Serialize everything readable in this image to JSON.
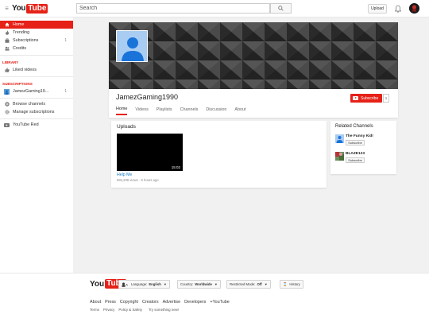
{
  "masthead": {
    "logo_you": "You",
    "logo_tube": "Tube",
    "search_placeholder": "Search",
    "upload_label": "Upload"
  },
  "sidebar": {
    "items": [
      {
        "label": "Home",
        "icon": "home-icon"
      },
      {
        "label": "Trending",
        "icon": "flame-icon"
      },
      {
        "label": "Subscriptions",
        "icon": "subscriptions-icon",
        "count": "1"
      },
      {
        "label": "Credits",
        "icon": "credits-icon"
      }
    ],
    "library_heading": "LIBRARY",
    "library_items": [
      {
        "label": "Liked videos",
        "icon": "thumbs-up-icon"
      }
    ],
    "subscriptions_heading": "SUBSCRIPTIONS",
    "subscriptions": [
      {
        "label": "JamezGaming19...",
        "count": "1"
      }
    ],
    "extra_items": [
      {
        "label": "Browse channels",
        "icon": "plus-circle-icon"
      },
      {
        "label": "Manage subscriptions",
        "icon": "gear-icon"
      }
    ],
    "red_item": {
      "label": "YouTube Red",
      "icon": "youtube-red-icon"
    }
  },
  "channel": {
    "name": "JamezGaming1990",
    "subscribe_label": "Subscribe",
    "subscriber_count": "1",
    "tabs": [
      "Home",
      "Videos",
      "Playlists",
      "Channels",
      "Discussion",
      "About"
    ],
    "active_tab": "Home"
  },
  "uploads": {
    "title": "Uploads",
    "video": {
      "title": "Help Me",
      "duration": "15:02",
      "meta": "992,208 views · 6 hours ago"
    }
  },
  "related": {
    "title": "Related Channels",
    "channels": [
      {
        "name": "The Funny Kid!",
        "subscribe_label": "Subscribe"
      },
      {
        "name": "BLAZE123",
        "subscribe_label": "Subscribe"
      }
    ]
  },
  "footer": {
    "logo_you": "You",
    "logo_tube": "Tube",
    "language_label": "Language:",
    "language_value": "English",
    "country_label": "Country:",
    "country_value": "Worldwide",
    "restricted_label": "Restricted Mode:",
    "restricted_value": "Off",
    "history_label": "History",
    "links": [
      "About",
      "Press",
      "Copyright",
      "Creators",
      "Advertise",
      "Developers",
      "+YouTube"
    ],
    "sublinks": [
      "Terms",
      "Privacy",
      "Policy & Safety",
      "Try something new!"
    ]
  },
  "colors": {
    "brand_red": "#e62117",
    "link_blue": "#167ac6"
  }
}
